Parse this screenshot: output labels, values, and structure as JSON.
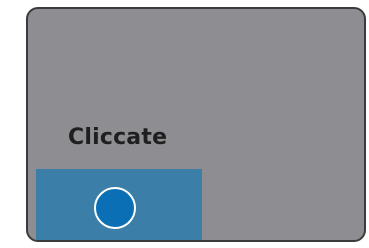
{
  "panel": {
    "label": "Cliccate"
  },
  "colors": {
    "panel_bg": "#8e8e92",
    "panel_border": "#3b3b3d",
    "target_bg": "#3b7ea8",
    "circle_fill": "#0a6fb4",
    "circle_border": "#ffffff"
  },
  "icons": {
    "target_circle": "circle-button-icon"
  }
}
